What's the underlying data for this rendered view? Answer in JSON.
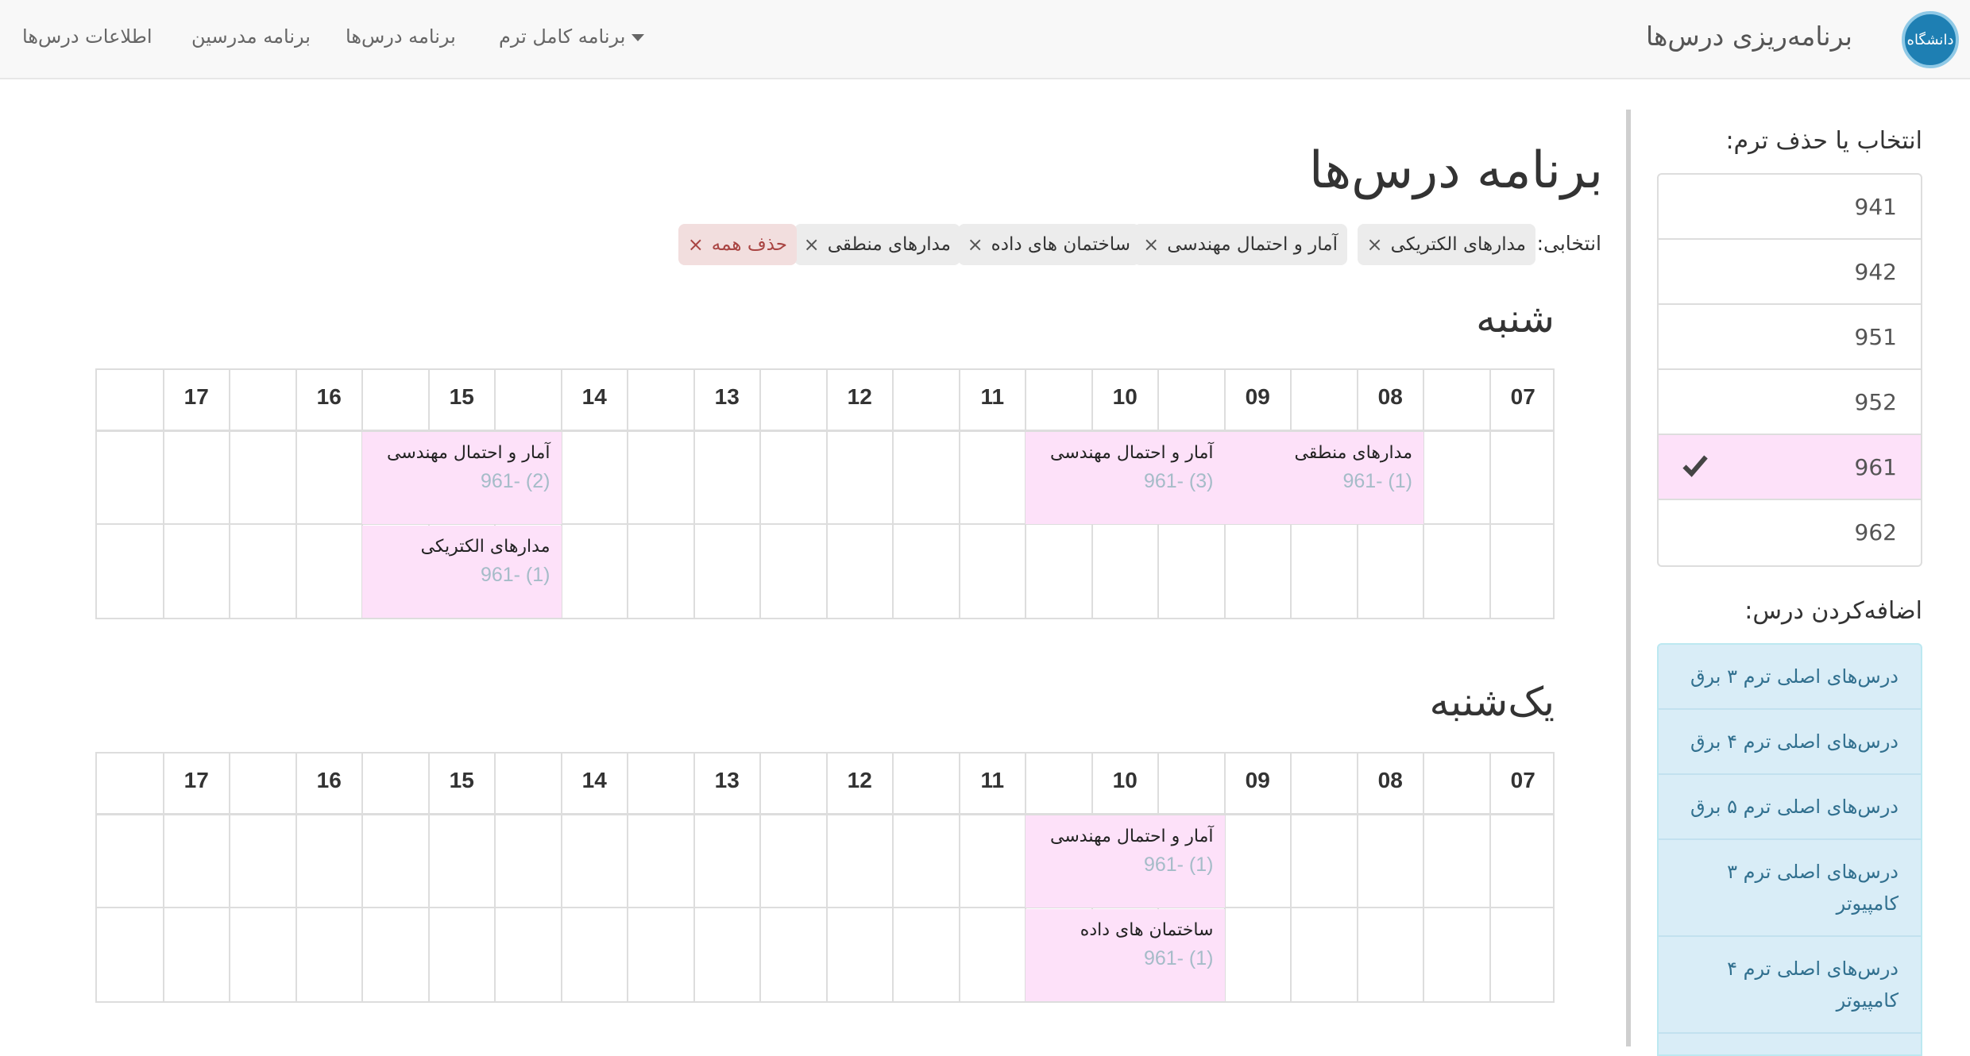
{
  "navbar": {
    "brand": "برنامه‌ریزی درس‌ها",
    "logo_text": "دانشگاه",
    "links": [
      "برنامه کامل ترم",
      "برنامه درس‌ها",
      "برنامه مدرسین",
      "اطلاعات درس‌ها"
    ]
  },
  "sidebar": {
    "term_heading": "انتخاب یا حذف ترم:",
    "terms": [
      {
        "label": "941",
        "selected": false
      },
      {
        "label": "942",
        "selected": false
      },
      {
        "label": "951",
        "selected": false
      },
      {
        "label": "952",
        "selected": false
      },
      {
        "label": "961",
        "selected": true
      },
      {
        "label": "962",
        "selected": false
      }
    ],
    "course_heading": "اضافه‌کردن درس:",
    "course_groups": [
      "درس‌های اصلی ترم ۳ برق",
      "درس‌های اصلی ترم ۴ برق",
      "درس‌های اصلی ترم ۵ برق",
      "درس‌های اصلی ترم ۳ کامپیوتر",
      "درس‌های اصلی ترم ۴ کامپیوتر"
    ]
  },
  "main": {
    "title": "برنامه درس‌ها",
    "selected_label": "انتخابی:",
    "chips": [
      "مدارهای الکتریکی",
      "آمار و احتمال مهندسی",
      "ساختمان های داده",
      "مدارهای منطقی"
    ],
    "clear_all": "حذف همه",
    "close_glyph": "×",
    "hours": [
      "07",
      "08",
      "09",
      "10",
      "11",
      "12",
      "13",
      "14",
      "15",
      "16",
      "17"
    ],
    "days": [
      {
        "name": "شنبه",
        "slots": [
          {
            "name": "مدارهای منطقی",
            "code": "961- (1)",
            "row": 0,
            "start": 8,
            "end": 9.5
          },
          {
            "name": "آمار و احتمال مهندسی",
            "code": "961- (3)",
            "row": 0,
            "start": 9.5,
            "end": 11
          },
          {
            "name": "آمار و احتمال مهندسی",
            "code": "961- (2)",
            "row": 0,
            "start": 14.5,
            "end": 16
          },
          {
            "name": "مدارهای الکتریکی",
            "code": "961- (1)",
            "row": 1,
            "start": 14.5,
            "end": 16
          }
        ]
      },
      {
        "name": "یک‌شنبه",
        "slots": [
          {
            "name": "آمار و احتمال مهندسی",
            "code": "961- (1)",
            "row": 0,
            "start": 9.5,
            "end": 11
          },
          {
            "name": "ساختمان های داده",
            "code": "961- (1)",
            "row": 1,
            "start": 9.5,
            "end": 11
          }
        ]
      }
    ]
  },
  "colors": {
    "slot_bg": "#fde1f9",
    "selected_term_bg": "#fde1f9",
    "course_panel_bg": "#d9edf7",
    "danger": "#a94442"
  }
}
